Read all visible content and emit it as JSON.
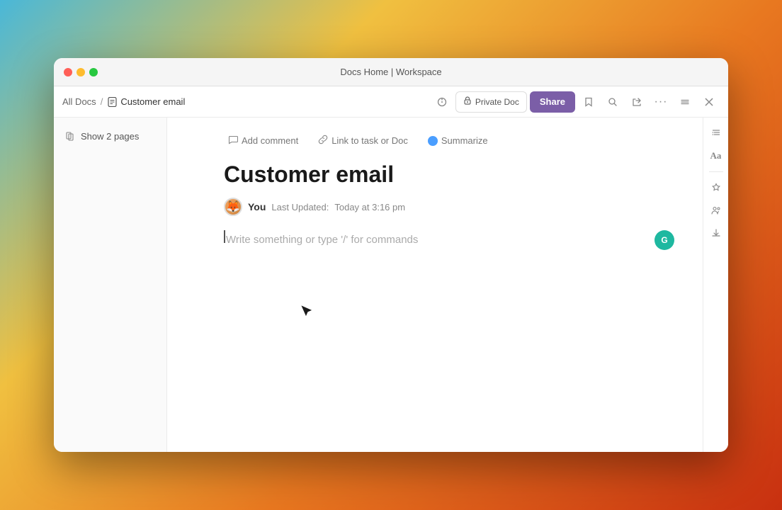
{
  "window": {
    "title": "Docs Home | Workspace"
  },
  "titlebar": {
    "title": "Docs Home | Workspace",
    "traffic_lights": {
      "close": "close",
      "minimize": "minimize",
      "maximize": "maximize"
    }
  },
  "toolbar": {
    "breadcrumb": {
      "parent": "All Docs",
      "separator": "/",
      "current": "Customer email"
    },
    "buttons": {
      "private": "Private Doc",
      "share": "Share",
      "bookmark": "★",
      "search": "🔍",
      "export": "↗",
      "more": "···",
      "minimize_win": "−",
      "close_win": "✕"
    }
  },
  "sidebar": {
    "items": [
      {
        "label": "Show 2 pages",
        "icon": "pages-icon"
      }
    ]
  },
  "content": {
    "actions": [
      {
        "label": "Add comment",
        "icon": "comment-icon"
      },
      {
        "label": "Link to task or Doc",
        "icon": "link-icon"
      },
      {
        "label": "Summarize",
        "icon": "summarize-icon"
      }
    ],
    "title": "Customer email",
    "author": {
      "name": "You",
      "last_updated_label": "Last Updated:",
      "last_updated_value": "Today at 3:16 pm"
    },
    "editor_placeholder": "Write something or type '/' for commands",
    "online_users_count": "G"
  },
  "right_sidebar": {
    "buttons": [
      {
        "icon": "list-icon",
        "label": "Table of contents"
      },
      {
        "icon": "text-icon",
        "label": "Text format"
      },
      {
        "icon": "divider",
        "label": ""
      },
      {
        "icon": "star-icon",
        "label": "Favorites"
      },
      {
        "icon": "users-icon",
        "label": "Collaborators"
      },
      {
        "icon": "download-icon",
        "label": "Export"
      }
    ]
  }
}
